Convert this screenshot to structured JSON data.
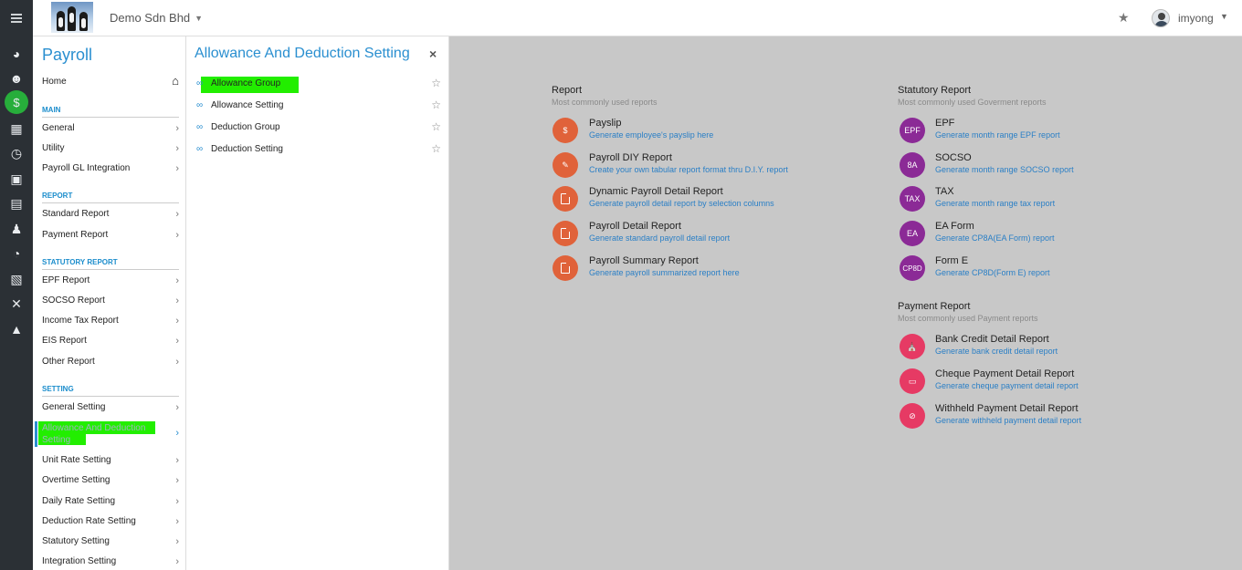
{
  "topbar": {
    "company": "Demo Sdn Bhd",
    "username": "imyong"
  },
  "rail": {
    "icons": [
      "dashboard-icon",
      "users-icon",
      "payroll-icon",
      "calendar-icon",
      "clock-icon",
      "document-icon",
      "calendar-check-icon",
      "user-tie-icon",
      "pie-chart-icon",
      "table-icon",
      "tools-icon",
      "upload-icon"
    ]
  },
  "menu": {
    "title": "Payroll",
    "home": "Home",
    "sections": {
      "main": "MAIN",
      "report": "REPORT",
      "statutory": "STATUTORY REPORT",
      "setting": "SETTING"
    },
    "main_items": [
      "General",
      "Utility",
      "Payroll GL Integration"
    ],
    "report_items": [
      "Standard Report",
      "Payment Report"
    ],
    "statutory_items": [
      "EPF Report",
      "SOCSO Report",
      "Income Tax Report",
      "EIS Report",
      "Other Report"
    ],
    "setting_items": [
      "General Setting",
      "Allowance And Deduction Setting",
      "Unit Rate Setting",
      "Overtime Setting",
      "Daily Rate Setting",
      "Deduction Rate Setting",
      "Statutory Setting",
      "Integration Setting"
    ]
  },
  "panel": {
    "title": "Allowance And Deduction Setting",
    "close": "×",
    "items": [
      "Allowance Group",
      "Allowance Setting",
      "Deduction Group",
      "Deduction Setting"
    ]
  },
  "report": {
    "title": "Report",
    "subtitle": "Most commonly used reports",
    "items": [
      {
        "title": "Payslip",
        "desc": "Generate employee's payslip here",
        "icon": "dollar-icon"
      },
      {
        "title": "Payroll DIY Report",
        "desc": "Create your own tabular report format thru D.I.Y. report",
        "icon": "pencil-icon"
      },
      {
        "title": "Dynamic Payroll Detail Report",
        "desc": "Generate payroll detail report by selection columns",
        "icon": "file-icon"
      },
      {
        "title": "Payroll Detail Report",
        "desc": "Generate standard payroll detail report",
        "icon": "file-icon"
      },
      {
        "title": "Payroll Summary Report",
        "desc": "Generate payroll summarized report here",
        "icon": "file-icon"
      }
    ]
  },
  "statutory": {
    "title": "Statutory Report",
    "subtitle": "Most commonly used Goverment reports",
    "items": [
      {
        "badge": "EPF",
        "title": "EPF",
        "desc": "Generate month range EPF report"
      },
      {
        "badge": "8A",
        "title": "SOCSO",
        "desc": "Generate month range SOCSO report"
      },
      {
        "badge": "TAX",
        "title": "TAX",
        "desc": "Generate month range tax report"
      },
      {
        "badge": "EA",
        "title": "EA Form",
        "desc": "Generate CP8A(EA Form) report"
      },
      {
        "badge": "CP8D",
        "title": "Form E",
        "desc": "Generate CP8D(Form E) report"
      }
    ]
  },
  "payment": {
    "title": "Payment Report",
    "subtitle": "Most commonly used Payment reports",
    "items": [
      {
        "title": "Bank Credit Detail Report",
        "desc": "Generate bank credit detail report",
        "icon": "bank-icon"
      },
      {
        "title": "Cheque Payment Detail Report",
        "desc": "Generate cheque payment detail report",
        "icon": "cheque-icon"
      },
      {
        "title": "Withheld Payment Detail Report",
        "desc": "Generate withheld payment detail report",
        "icon": "ban-icon"
      }
    ]
  },
  "colors": {
    "accent": "#2a8fd0",
    "highlight": "#22ee00",
    "orange": "#e0623a",
    "purple": "#8b2a96",
    "pink": "#e63a64",
    "rail": "#2b3035"
  }
}
